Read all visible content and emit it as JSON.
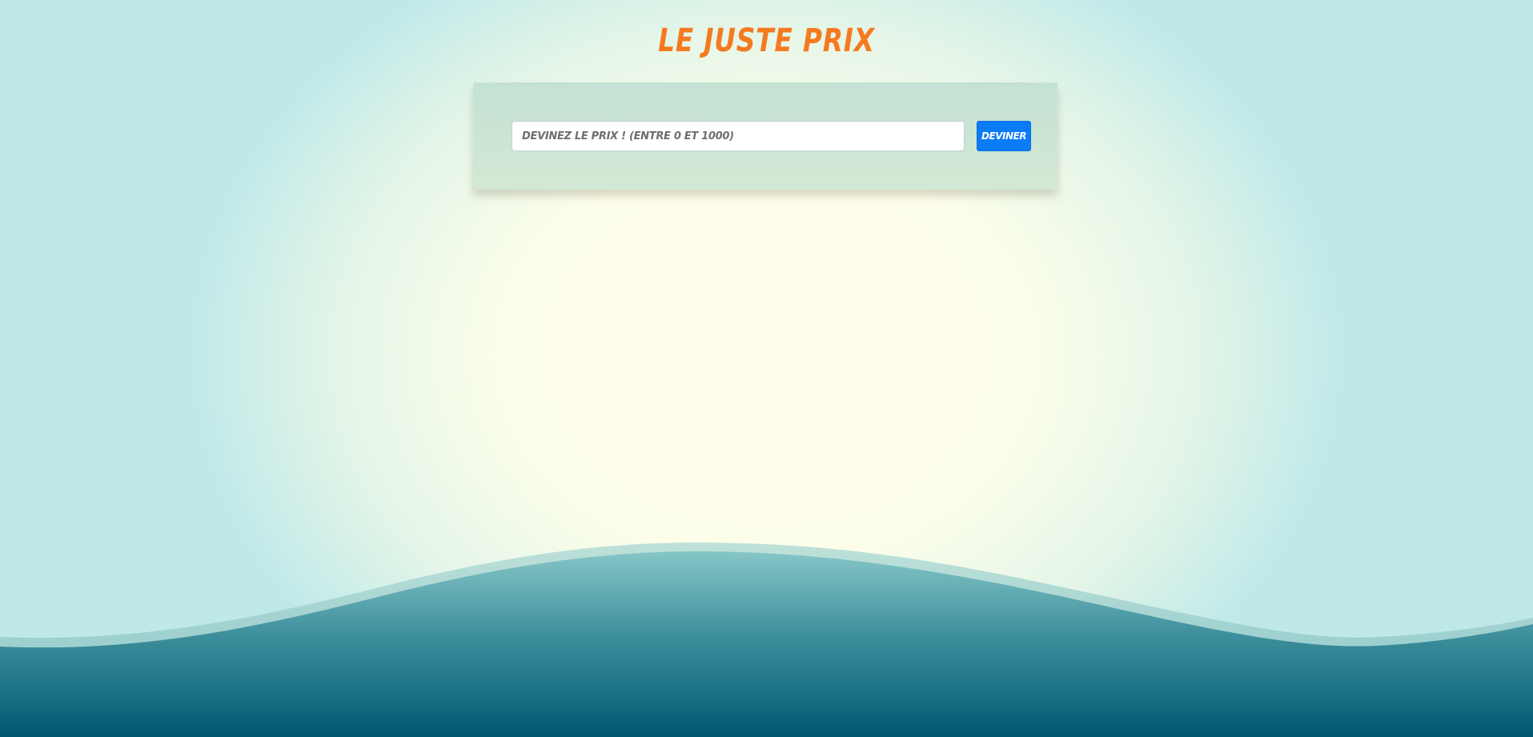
{
  "page": {
    "title": "Le Juste Prix"
  },
  "form": {
    "input_placeholder": "Devinez le prix ! (entre 0 et 1000)",
    "input_value": "",
    "button_label": "Deviner"
  },
  "colors": {
    "title": "#f57a1f",
    "button": "#0b7cf6",
    "panel": "#c9e4d4",
    "wave_dark": "#005a70",
    "wave_light": "#8ccdcc"
  }
}
